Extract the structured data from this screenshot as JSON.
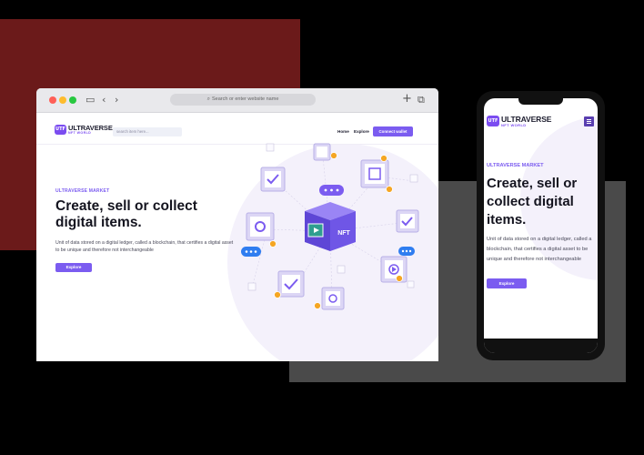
{
  "browser": {
    "url_placeholder": "Search or enter website name"
  },
  "site": {
    "logo": {
      "mark": "UTF",
      "name": "ULTRAVERSE",
      "tagline": "NFT WORLD"
    },
    "search_placeholder": "search item here...",
    "nav_links": [
      "Home",
      "Explore"
    ],
    "connect_label": "Connect wallet",
    "eyebrow": "ULTRAVERSE MARKET",
    "headline": "Create, sell or collect digital items.",
    "description": "Unit of data stored on a digital ledger, called a blockchain, that certifies a digital asset to be unique and therefore not interchangeable",
    "explore_label": "Explore",
    "cube_label": "NFT"
  },
  "mobile": {
    "eyebrow": "ULTRAVERSE MARKET",
    "headline": "Create, sell or collect digital items.",
    "description": "Unit of data stored on a digital ledger, called a blockchain, that certifies a digital asset to be unique and therefore not interchangeable",
    "explore_label": "Explore"
  },
  "colors": {
    "accent": "#7b5cf0",
    "backdrop_red": "#6b1a1a",
    "backdrop_gray": "#4a4a4a",
    "coin": "#f5a623"
  }
}
